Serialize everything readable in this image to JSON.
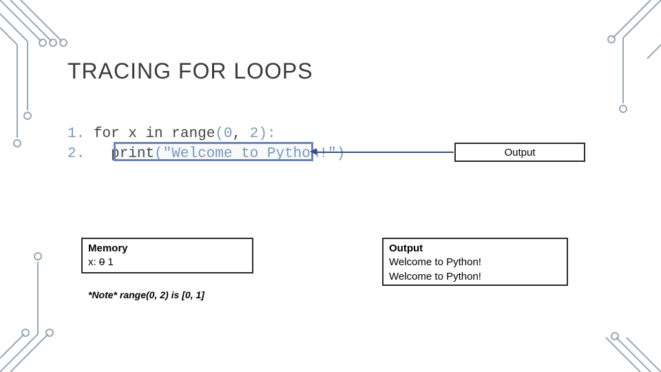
{
  "title": "TRACING FOR LOOPS",
  "code": {
    "ln1": "1.",
    "ln2": "2.",
    "line1_kw_for": "for",
    "line1_var": " x ",
    "line1_kw_in": "in",
    "line1_space": " ",
    "line1_fn": "range",
    "line1_p1": "(",
    "line1_a1": "0",
    "line1_comma": ", ",
    "line1_a2": "2",
    "line1_p2": "):",
    "line2_indent": "   ",
    "line2_fn": "print",
    "line2_p1": "(",
    "line2_str": "\"Welcome to Python!\"",
    "line2_p2": ")"
  },
  "output_label": "Output",
  "memory": {
    "title": "Memory",
    "var_label": "x:",
    "old_value": "0",
    "new_value": " 1"
  },
  "note": "*Note* range(0, 2) is [0, 1]",
  "output_box": {
    "title": "Output",
    "line1": "Welcome to Python!",
    "line2": "Welcome to Python!"
  }
}
